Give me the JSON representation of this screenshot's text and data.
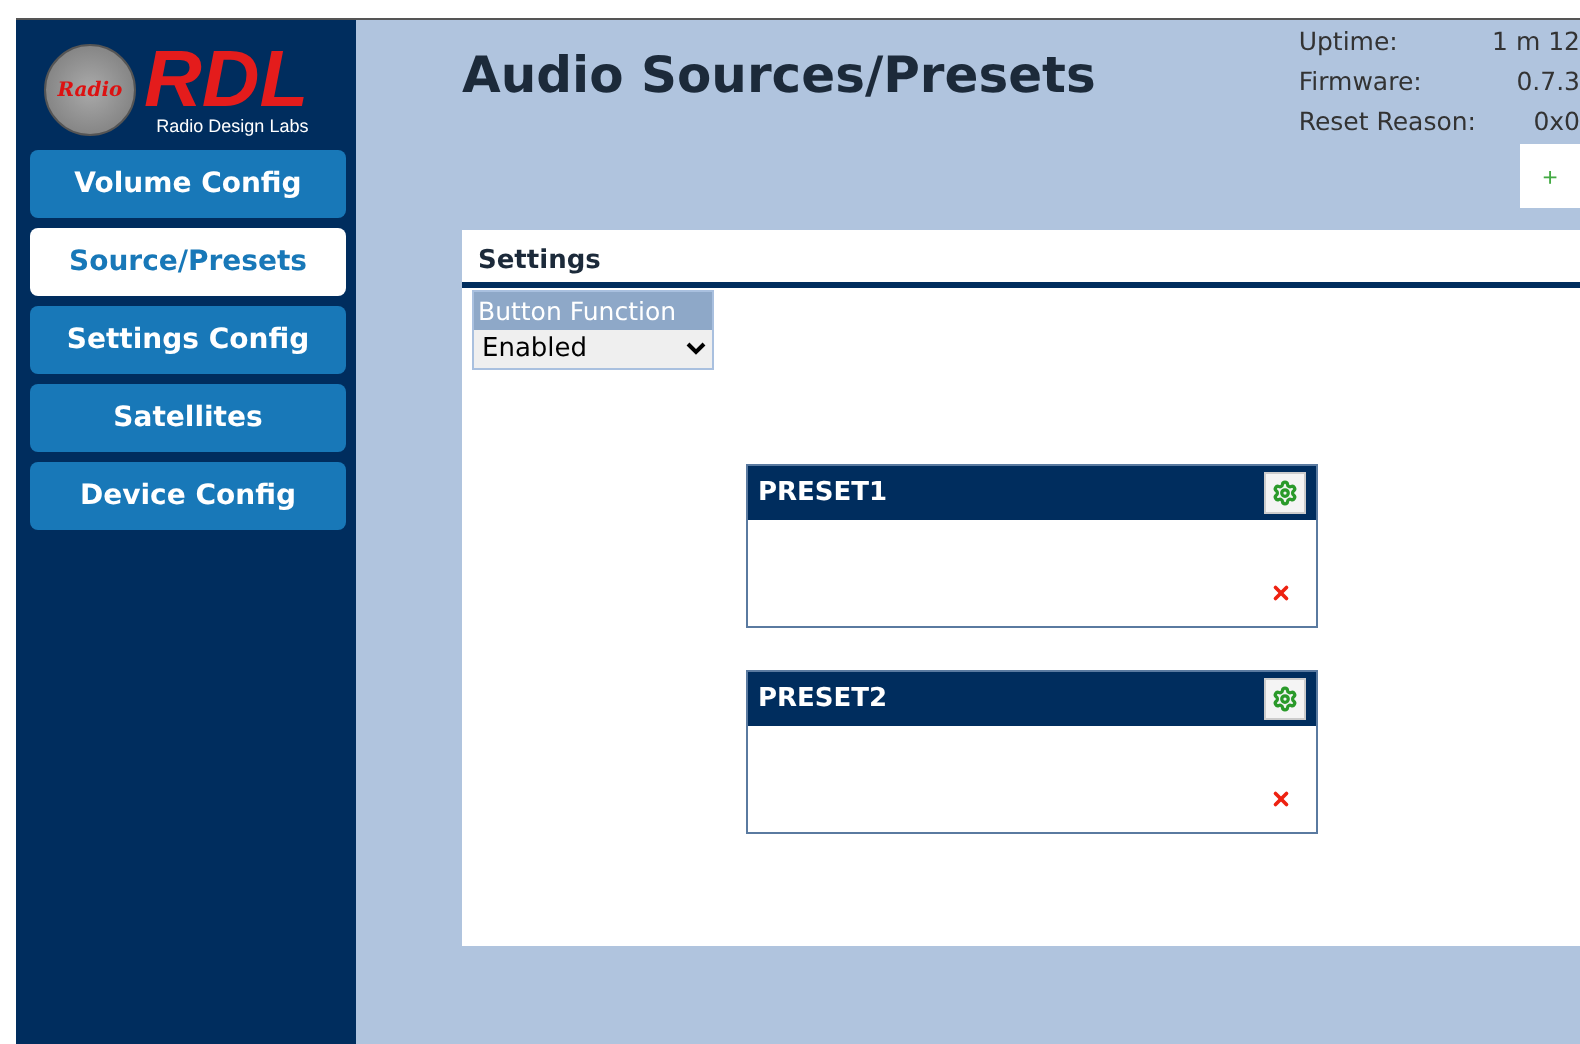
{
  "logo": {
    "badge": "Radio",
    "brand": "RDL",
    "tagline": "Radio Design Labs"
  },
  "nav": [
    {
      "label": "Volume Config",
      "selected": false
    },
    {
      "label": "Source/Presets",
      "selected": true
    },
    {
      "label": "Settings Config",
      "selected": false
    },
    {
      "label": "Satellites",
      "selected": false
    },
    {
      "label": "Device Config",
      "selected": false
    }
  ],
  "title": "Audio Sources/Presets",
  "status": [
    {
      "label": "Uptime:",
      "value": "1 m 12"
    },
    {
      "label": "Firmware:",
      "value": "0.7.3"
    },
    {
      "label": "Reset Reason:",
      "value": "0x0"
    }
  ],
  "add_button": "+",
  "settings": {
    "title": "Settings",
    "field_label": "Button Function",
    "field_value": "Enabled"
  },
  "presets": [
    {
      "name": "PRESET1"
    },
    {
      "name": "PRESET2"
    }
  ]
}
